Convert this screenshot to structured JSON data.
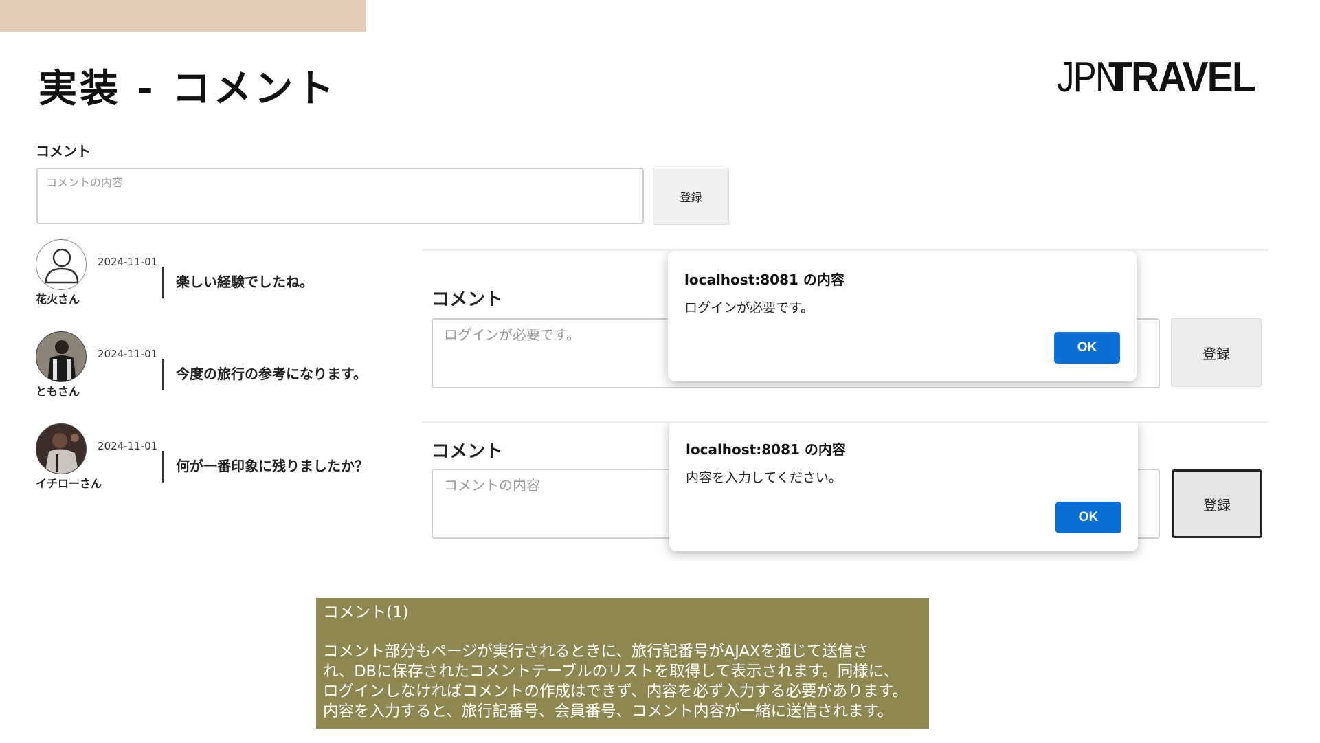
{
  "slide": {
    "title": "実装 - コメント",
    "logo_thin": "JPN",
    "logo_bold": "TRAVEL"
  },
  "comment_form": {
    "label": "コメント",
    "placeholder": "コメントの内容",
    "submit_label": "登録"
  },
  "comments": [
    {
      "date": "2024-11-01",
      "user": "花火さん",
      "text": "楽しい経験でしたね。",
      "avatar": "default-user-icon"
    },
    {
      "date": "2024-11-01",
      "user": "ともさん",
      "text": "今度の旅行の参考になります。",
      "avatar": "user-photo"
    },
    {
      "date": "2024-11-01",
      "user": "イチローさん",
      "text": "何が一番印象に残りましたか？",
      "avatar": "user-photo"
    }
  ],
  "panel_login": {
    "label": "コメント",
    "placeholder": "ログインが必要です。",
    "submit_label": "登録",
    "dialog": {
      "title": "localhost:8081 の内容",
      "message": "ログインが必要です。",
      "ok": "OK"
    }
  },
  "panel_empty": {
    "label": "コメント",
    "placeholder": "コメントの内容",
    "submit_label": "登録",
    "dialog": {
      "title": "localhost:8081 の内容",
      "message": "内容を入力してください。",
      "ok": "OK"
    }
  },
  "note": {
    "title": "コメント(1)",
    "lines": [
      "コメント部分もページが実行されるときに、旅行記番号がAJAXを通じて送信さ",
      "れ、DBに保存されたコメントテーブルのリストを取得して表示されます。同様に、",
      "ログインしなければコメントの作成はできず、内容を必ず入力する必要があります。",
      "内容を入力すると、旅行記番号、会員番号、コメント内容が一緒に送信されます。"
    ]
  },
  "colors": {
    "topbar": "#dfcbb6",
    "note_bg": "#8f8750",
    "ok_button": "#0b6fd8"
  }
}
